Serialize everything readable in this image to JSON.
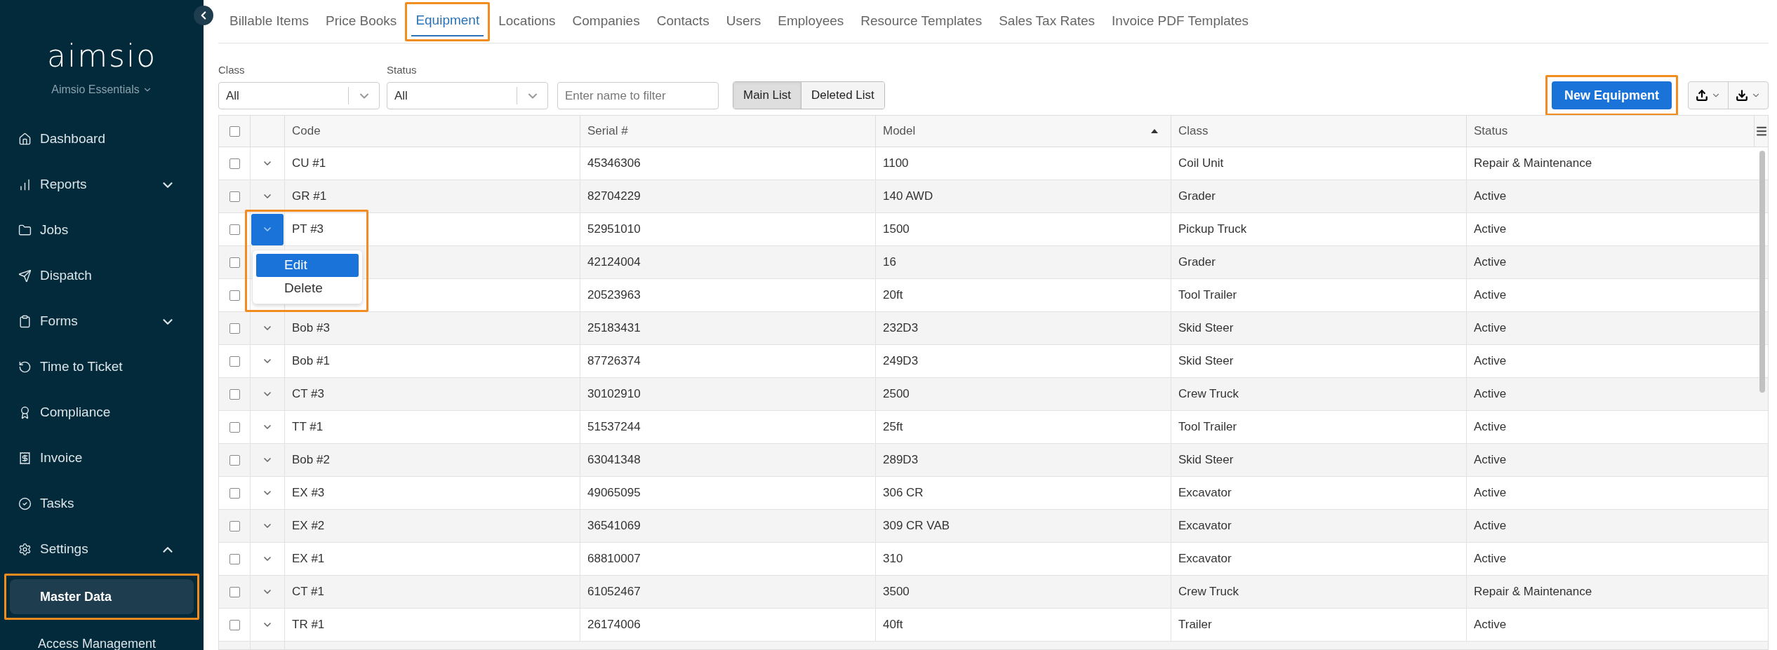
{
  "sidebar": {
    "logo": "aimsio",
    "product": "Aimsio Essentials",
    "items": [
      {
        "label": "Dashboard",
        "selected": false
      },
      {
        "label": "Reports",
        "selected": false,
        "expanded": false
      },
      {
        "label": "Jobs",
        "selected": false
      },
      {
        "label": "Dispatch",
        "selected": false
      },
      {
        "label": "Forms",
        "selected": false,
        "expanded": false
      },
      {
        "label": "Time to Ticket",
        "selected": false
      },
      {
        "label": "Compliance",
        "selected": false
      },
      {
        "label": "Invoice",
        "selected": false
      },
      {
        "label": "Tasks",
        "selected": false
      },
      {
        "label": "Settings",
        "selected": false,
        "expanded": true,
        "children": [
          {
            "label": "Master Data",
            "selected": true,
            "highlighted": true
          },
          {
            "label": "Access Management",
            "selected": false,
            "highlighted": false
          }
        ]
      }
    ]
  },
  "tabs": [
    {
      "label": "Billable Items",
      "selected": false,
      "highlighted": false
    },
    {
      "label": "Price Books",
      "selected": false,
      "highlighted": false
    },
    {
      "label": "Equipment",
      "selected": true,
      "highlighted": true
    },
    {
      "label": "Locations",
      "selected": false,
      "highlighted": false
    },
    {
      "label": "Companies",
      "selected": false,
      "highlighted": false
    },
    {
      "label": "Contacts",
      "selected": false,
      "highlighted": false
    },
    {
      "label": "Users",
      "selected": false,
      "highlighted": false
    },
    {
      "label": "Employees",
      "selected": false,
      "highlighted": false
    },
    {
      "label": "Resource Templates",
      "selected": false,
      "highlighted": false
    },
    {
      "label": "Sales Tax Rates",
      "selected": false,
      "highlighted": false
    },
    {
      "label": "Invoice PDF Templates",
      "selected": false,
      "highlighted": false
    }
  ],
  "filters": {
    "class": {
      "label": "Class",
      "value": "All"
    },
    "status": {
      "label": "Status",
      "value": "All"
    },
    "search": {
      "placeholder": "Enter name to filter"
    },
    "lists": [
      {
        "label": "Main List",
        "selected": true
      },
      {
        "label": "Deleted List",
        "selected": false
      }
    ]
  },
  "new_button": {
    "label": "New Equipment",
    "highlighted": true
  },
  "table": {
    "select_all": {
      "checked": false
    },
    "columns": [
      {
        "label": "Code",
        "sorted": false
      },
      {
        "label": "Serial #",
        "sorted": false
      },
      {
        "label": "Model",
        "sorted": true
      },
      {
        "label": "Class",
        "sorted": false
      },
      {
        "label": "Status",
        "sorted": false
      }
    ],
    "rows": [
      {
        "code": "CU #1",
        "serial": "45346306",
        "model": "1100",
        "class": "Coil Unit",
        "status": "Repair & Maintenance",
        "checked": false,
        "menu_open": false
      },
      {
        "code": "GR #1",
        "serial": "82704229",
        "model": "140 AWD",
        "class": "Grader",
        "status": "Active",
        "checked": false,
        "menu_open": false
      },
      {
        "code": "PT #3",
        "serial": "52951010",
        "model": "1500",
        "class": "Pickup Truck",
        "status": "Active",
        "checked": false,
        "menu_open": true
      },
      {
        "serial": "42124004",
        "model": "16",
        "class": "Grader",
        "status": "Active",
        "checked": false
      },
      {
        "serial": "20523963",
        "model": "20ft",
        "class": "Tool Trailer",
        "status": "Active",
        "checked": false
      },
      {
        "code": "Bob #3",
        "serial": "25183431",
        "model": "232D3",
        "class": "Skid Steer",
        "status": "Active",
        "checked": false,
        "menu_open": false
      },
      {
        "code": "Bob #1",
        "serial": "87726374",
        "model": "249D3",
        "class": "Skid Steer",
        "status": "Active",
        "checked": false,
        "menu_open": false
      },
      {
        "code": "CT #3",
        "serial": "30102910",
        "model": "2500",
        "class": "Crew Truck",
        "status": "Active",
        "checked": false,
        "menu_open": false
      },
      {
        "code": "TT #1",
        "serial": "51537244",
        "model": "25ft",
        "class": "Tool Trailer",
        "status": "Active",
        "checked": false,
        "menu_open": false
      },
      {
        "code": "Bob #2",
        "serial": "63041348",
        "model": "289D3",
        "class": "Skid Steer",
        "status": "Active",
        "checked": false,
        "menu_open": false
      },
      {
        "code": "EX #3",
        "serial": "49065095",
        "model": "306 CR",
        "class": "Excavator",
        "status": "Active",
        "checked": false,
        "menu_open": false
      },
      {
        "code": "EX #2",
        "serial": "36541069",
        "model": "309 CR VAB",
        "class": "Excavator",
        "status": "Active",
        "checked": false,
        "menu_open": false
      },
      {
        "code": "EX #1",
        "serial": "68810007",
        "model": "310",
        "class": "Excavator",
        "status": "Active",
        "checked": false,
        "menu_open": false
      },
      {
        "code": "CT #1",
        "serial": "61052467",
        "model": "3500",
        "class": "Crew Truck",
        "status": "Repair & Maintenance",
        "checked": false,
        "menu_open": false
      },
      {
        "code": "TR #1",
        "serial": "26174006",
        "model": "40ft",
        "class": "Trailer",
        "status": "Active",
        "checked": false,
        "menu_open": false
      }
    ],
    "row_menu": {
      "highlighted": true,
      "items": [
        {
          "label": "Edit",
          "selected": true
        },
        {
          "label": "Delete",
          "selected": false
        }
      ]
    }
  }
}
